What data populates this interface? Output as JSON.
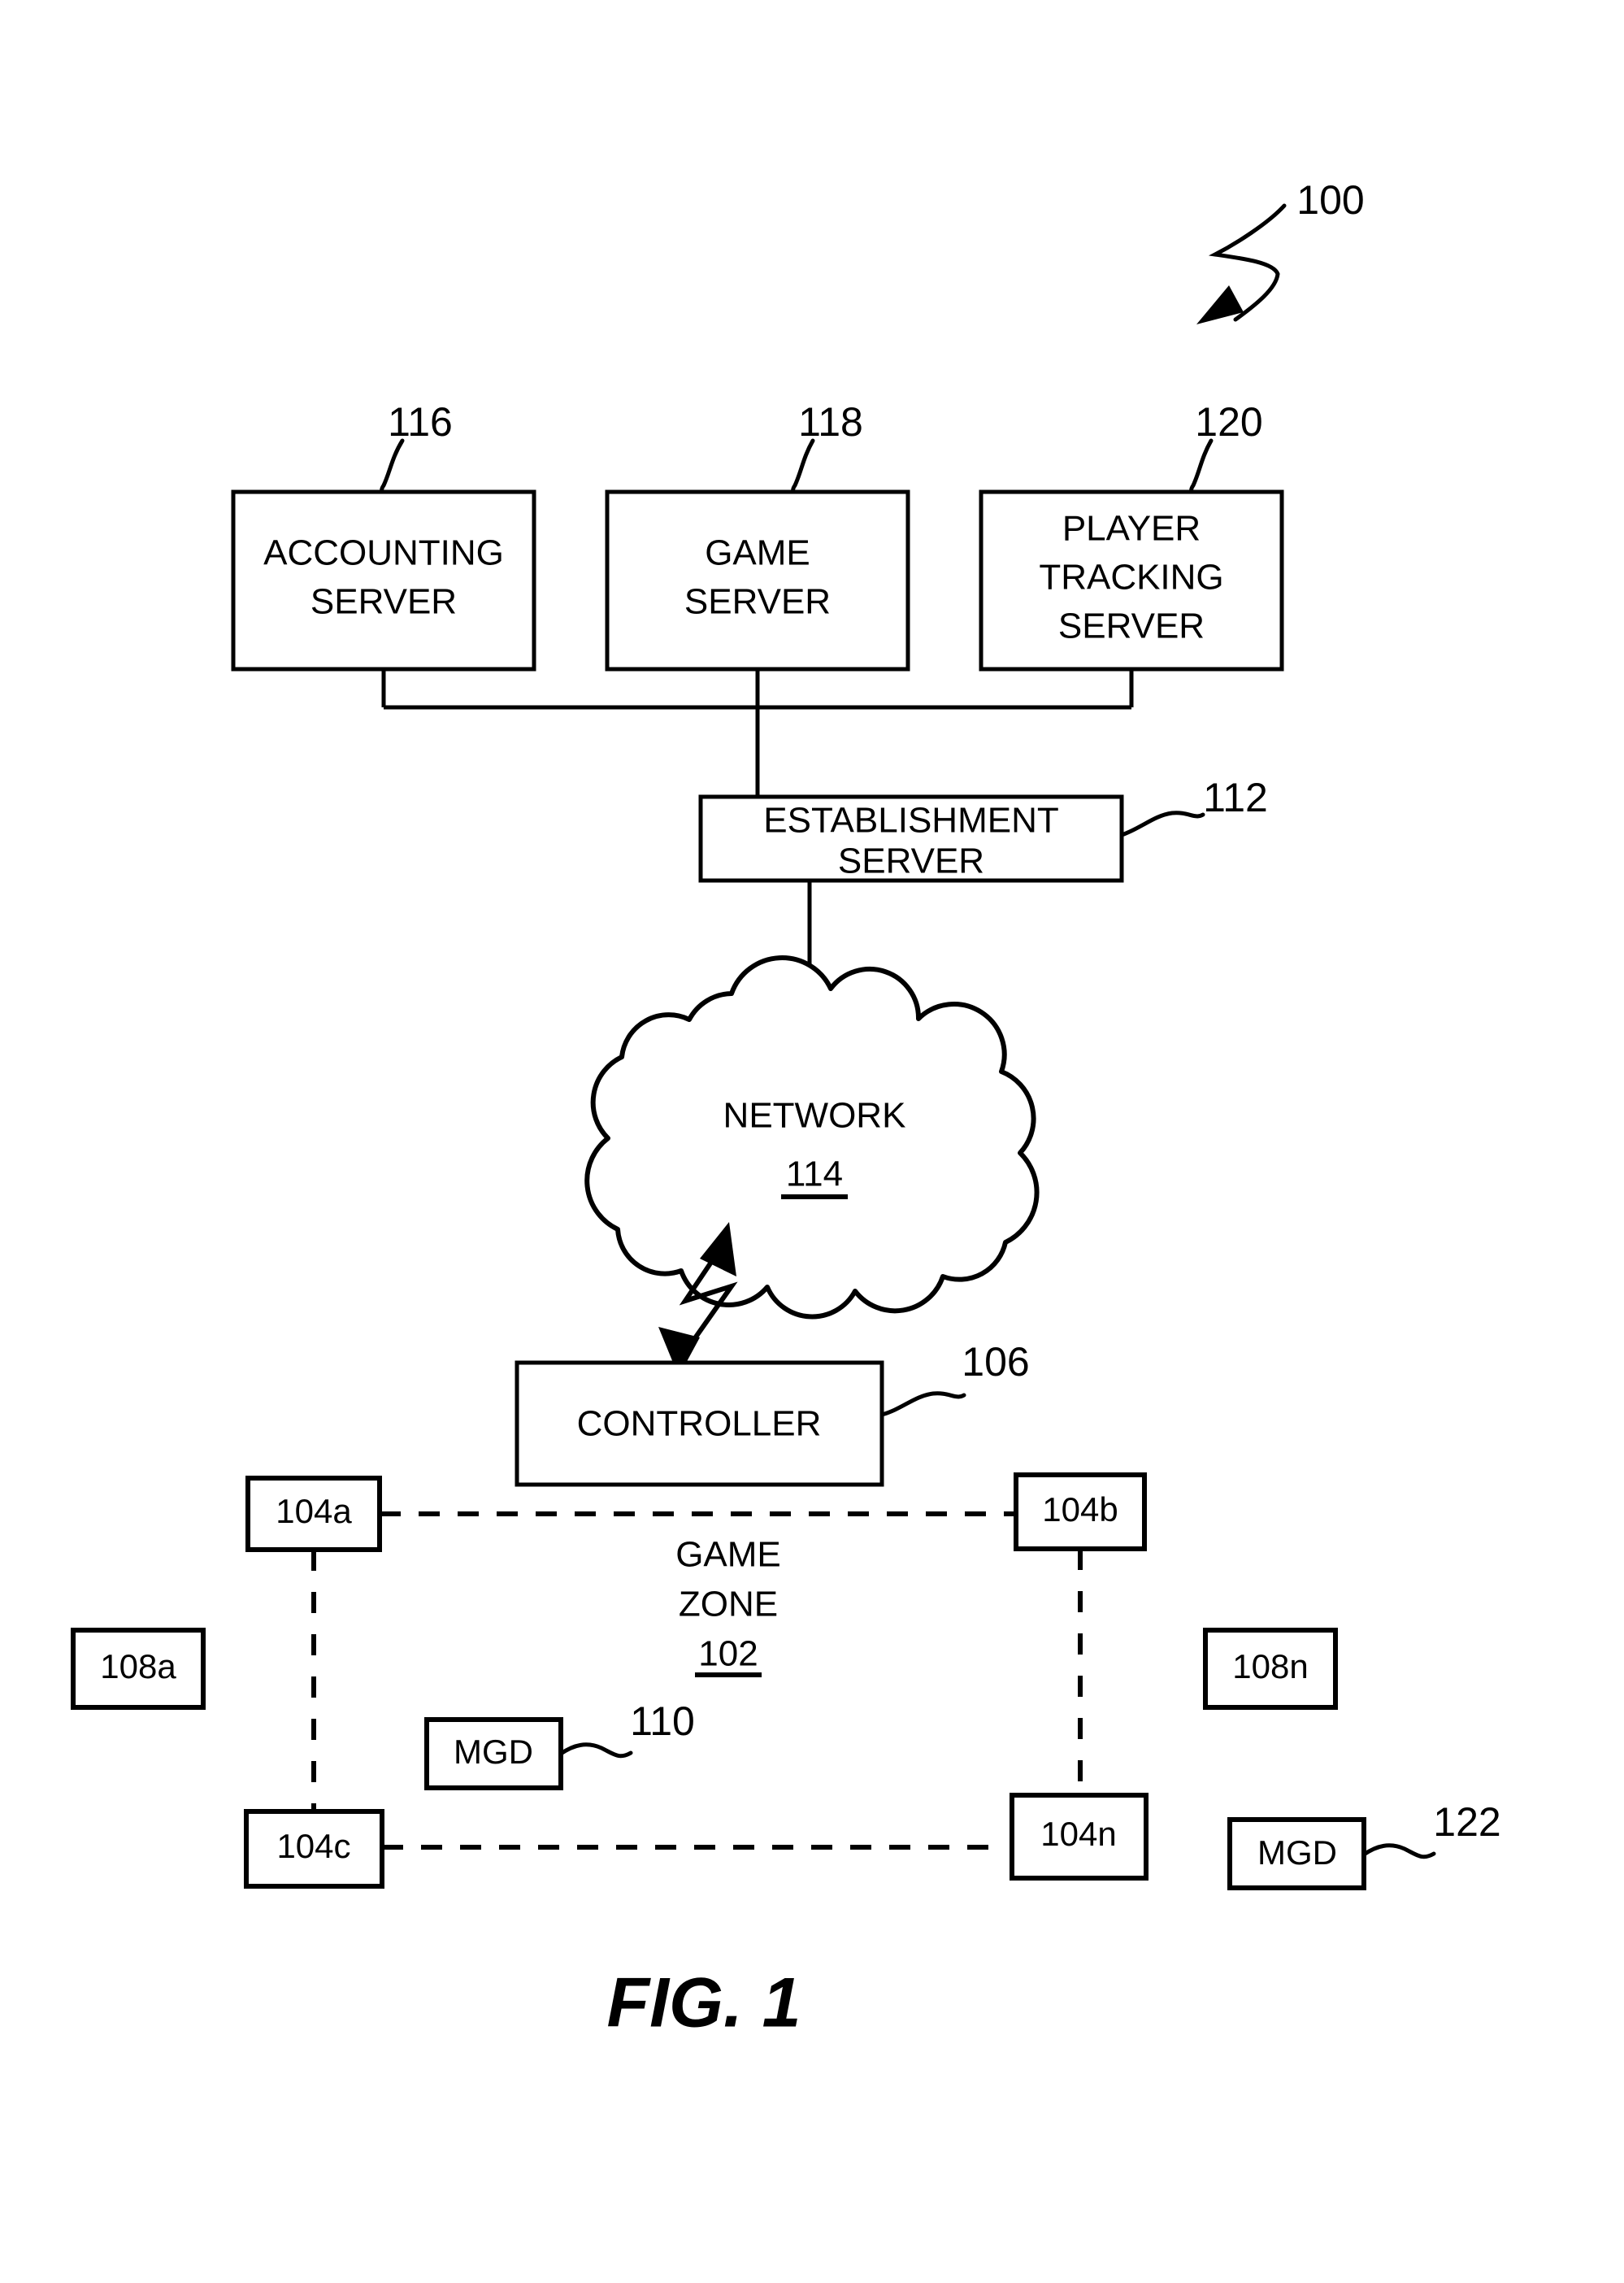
{
  "figure": {
    "caption": "FIG. 1",
    "system_ref": "100"
  },
  "servers": {
    "accounting": {
      "line1": "ACCOUNTING",
      "line2": "SERVER",
      "ref": "116"
    },
    "game": {
      "line1": "GAME",
      "line2": "SERVER",
      "ref": "118"
    },
    "player_tracking": {
      "line1": "PLAYER",
      "line2": "TRACKING",
      "line3": "SERVER",
      "ref": "120"
    },
    "establishment": {
      "line1": "ESTABLISHMENT",
      "line2": "SERVER",
      "ref": "112"
    }
  },
  "network": {
    "label": "NETWORK",
    "ref": "114"
  },
  "controller": {
    "label": "CONTROLLER",
    "ref": "106"
  },
  "game_zone": {
    "line1": "GAME",
    "line2": "ZONE",
    "ref": "102",
    "nodes": [
      {
        "label": "104a"
      },
      {
        "label": "104b"
      },
      {
        "label": "104c"
      },
      {
        "label": "104n"
      }
    ],
    "outer_boxes": [
      {
        "label": "108a"
      },
      {
        "label": "108n"
      }
    ],
    "mobile_devices": [
      {
        "label": "MGD",
        "ref": "110"
      },
      {
        "label": "MGD",
        "ref": "122"
      }
    ]
  },
  "colors": {
    "ink": "#000000",
    "paper": "#ffffff"
  }
}
